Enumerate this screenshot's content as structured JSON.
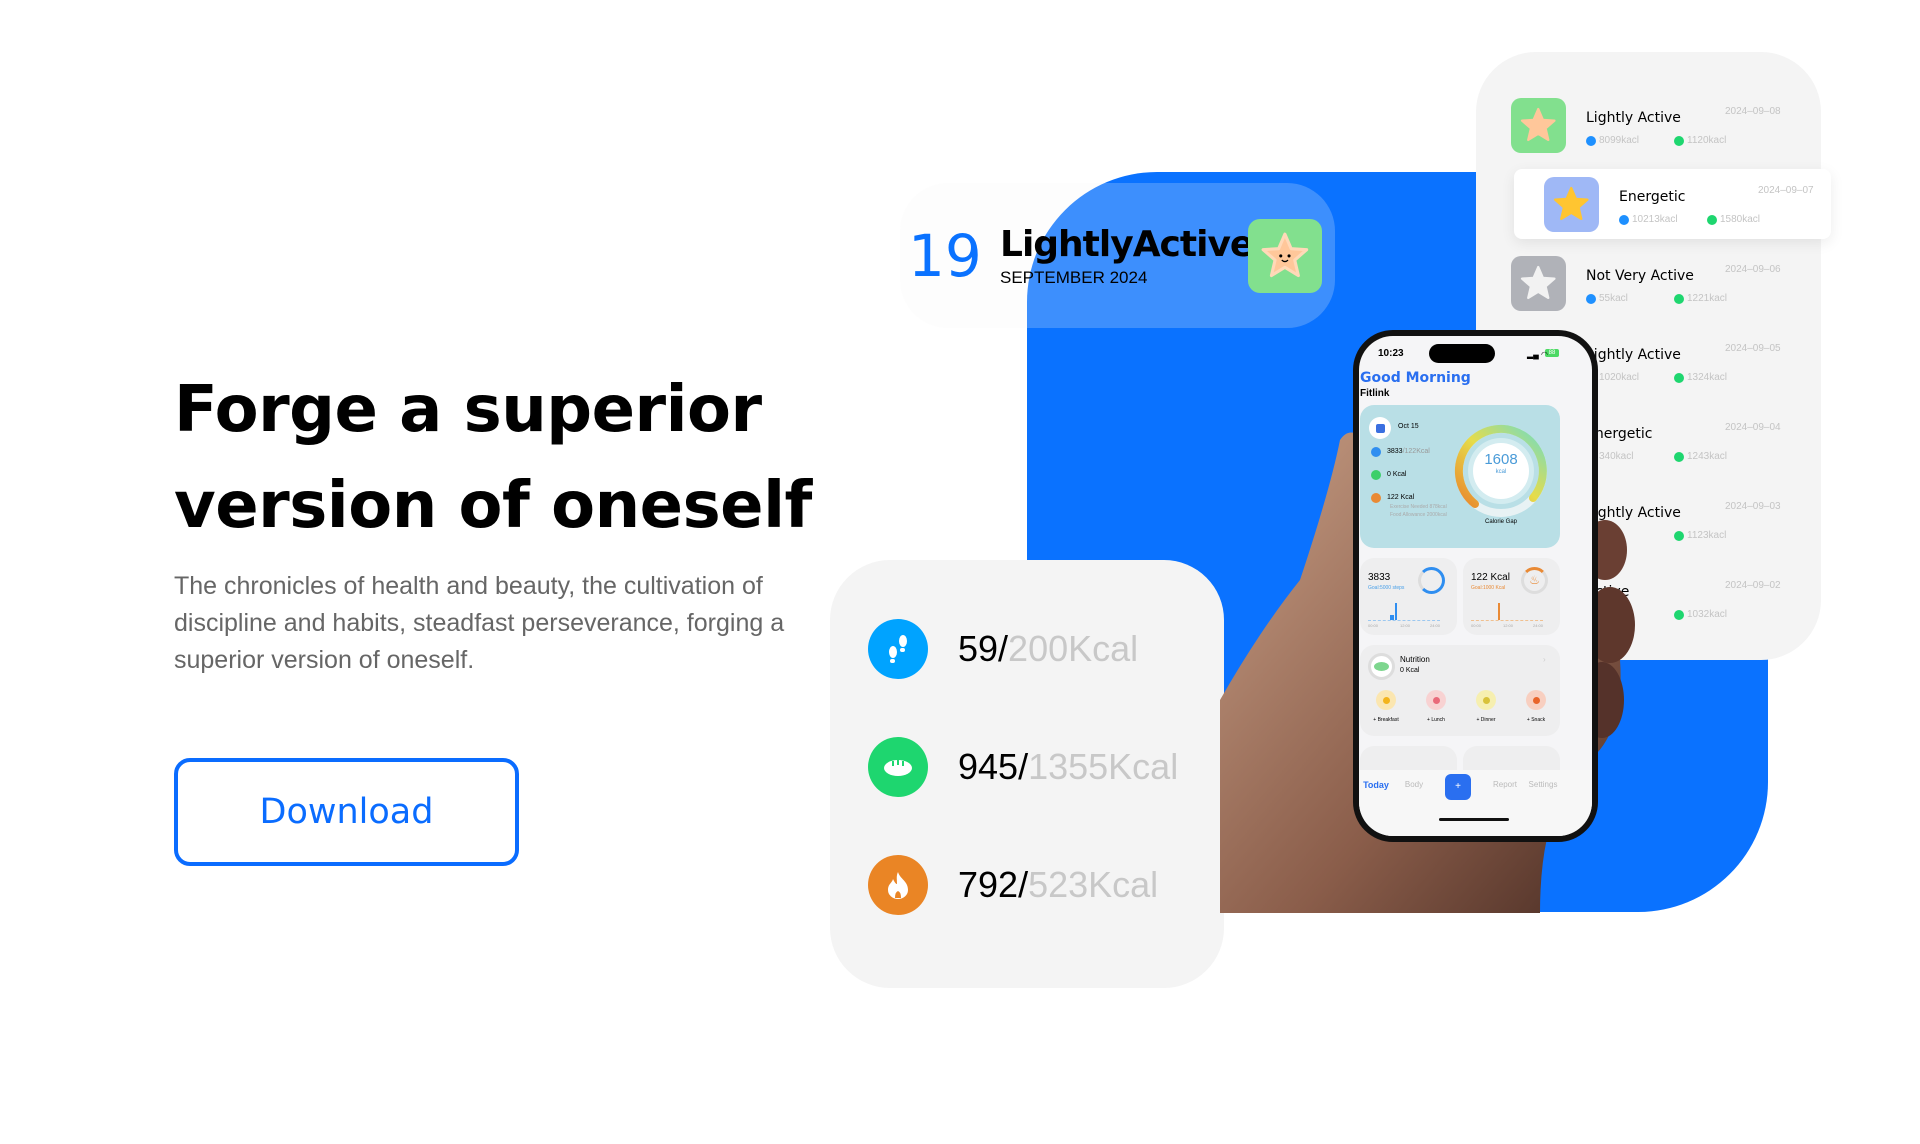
{
  "hero": {
    "headline": "Forge a superior version of oneself",
    "description": "The chronicles of health and beauty, the cultivation of discipline and habits, steadfast perseverance, forging a superior version of oneself.",
    "download_label": "Download"
  },
  "header_card": {
    "day": "19",
    "mood": "LightlyActive",
    "month": "SEPTEMBER 2024",
    "mood_color": "#82e08e"
  },
  "stats": [
    {
      "icon": "footprints-icon",
      "value": "59/",
      "goal": "200Kcal",
      "color": "#00a3ff"
    },
    {
      "icon": "bread-icon",
      "value": "945/",
      "goal": "1355Kcal",
      "color": "#1ed66f"
    },
    {
      "icon": "flame-icon",
      "value": "792/",
      "goal": "523Kcal",
      "color": "#ea8525"
    }
  ],
  "history": [
    {
      "mood": "Lightly Active",
      "date": "2024–09–08",
      "steps": "8099kacl",
      "food": "1120kacl",
      "color": "#82e08e"
    },
    {
      "mood": "Energetic",
      "date": "2024–09–07",
      "steps": "10213kacl",
      "food": "1580kacl",
      "color": "#9fb8f6"
    },
    {
      "mood": "Not Very Active",
      "date": "2024–09–06",
      "steps": "55kacl",
      "food": "1221kacl",
      "color": "#b0b2b8"
    },
    {
      "mood": "Lightly Active",
      "date": "2024–09–05",
      "steps": "1020kacl",
      "food": "1324kacl",
      "color": "#82e08e"
    },
    {
      "mood": "Energetic",
      "date": "2024–09–04",
      "steps": "340kacl",
      "food": "1243kacl",
      "color": "#9fb8f6"
    },
    {
      "mood": "Lightly Active",
      "date": "2024–09–03",
      "steps": "kacl",
      "food": "1123kacl",
      "color": "#82e08e"
    },
    {
      "mood": "Active",
      "date": "2024–09–02",
      "steps": "",
      "food": "1032kacl",
      "color": "#82e08e"
    }
  ],
  "phone": {
    "time": "10:23",
    "battery": "88",
    "greeting": "Good Morning",
    "app_name": "Fitlink",
    "date": "Oct 15",
    "steps_kcal": "3833",
    "steps_goal": "/122Kcal",
    "food": "0 Kcal",
    "burn": "122 Kcal",
    "exercise_needed": "Exercise Needed 878kcal",
    "food_allowance": "Food Allowance 2000kcal",
    "gap_value": "1608",
    "gap_unit": "kcal",
    "gap_label": "Calorie Gap",
    "steps_card": {
      "value": "3833",
      "goal": "Goal:5000 steps",
      "ticks": [
        "00:00",
        "12:00",
        "24:00"
      ]
    },
    "kcal_card": {
      "value": "122 Kcal",
      "goal": "Goal:1000 Kcal",
      "ticks": [
        "00:00",
        "12:00",
        "24:00"
      ]
    },
    "nutrition": {
      "title": "Nutrition",
      "value": "0 Kcal",
      "meals": [
        "+ Breakfast",
        "+ Lunch",
        "+ Dinner",
        "+ Snack"
      ]
    },
    "tabs": [
      "Today",
      "Body",
      "+",
      "Report",
      "Settings"
    ]
  }
}
